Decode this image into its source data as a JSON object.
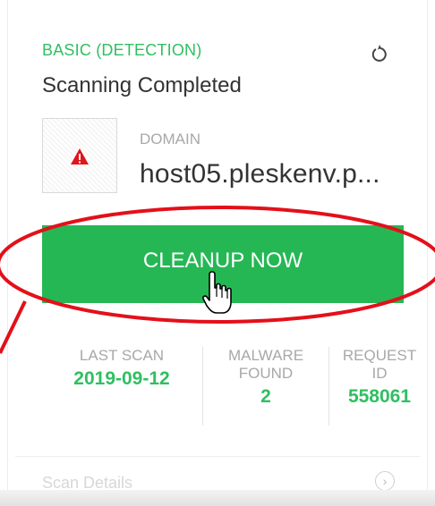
{
  "card": {
    "plan_label": "BASIC (DETECTION)",
    "status": "Scanning Completed",
    "refresh_icon": "refresh-icon"
  },
  "domain": {
    "label": "DOMAIN",
    "value": "host05.pleskenv.p...",
    "thumbnail_icon": "warning-triangle-icon"
  },
  "actions": {
    "cleanup_label": "CLEANUP NOW"
  },
  "stats": [
    {
      "label_lines": [
        "LAST SCAN"
      ],
      "value": "2019-09-12"
    },
    {
      "label_lines": [
        "MALWARE",
        "FOUND"
      ],
      "value": "2"
    },
    {
      "label_lines": [
        "REQUEST",
        "ID"
      ],
      "value": "558061"
    }
  ],
  "footer": {
    "details_label": "Scan Details",
    "chevron_icon": "chevron-right-icon"
  },
  "colors": {
    "accent_green": "#26b755",
    "text_green": "#2fbf61",
    "annotation_red": "#e3101a",
    "warning_red": "#e0151d"
  }
}
